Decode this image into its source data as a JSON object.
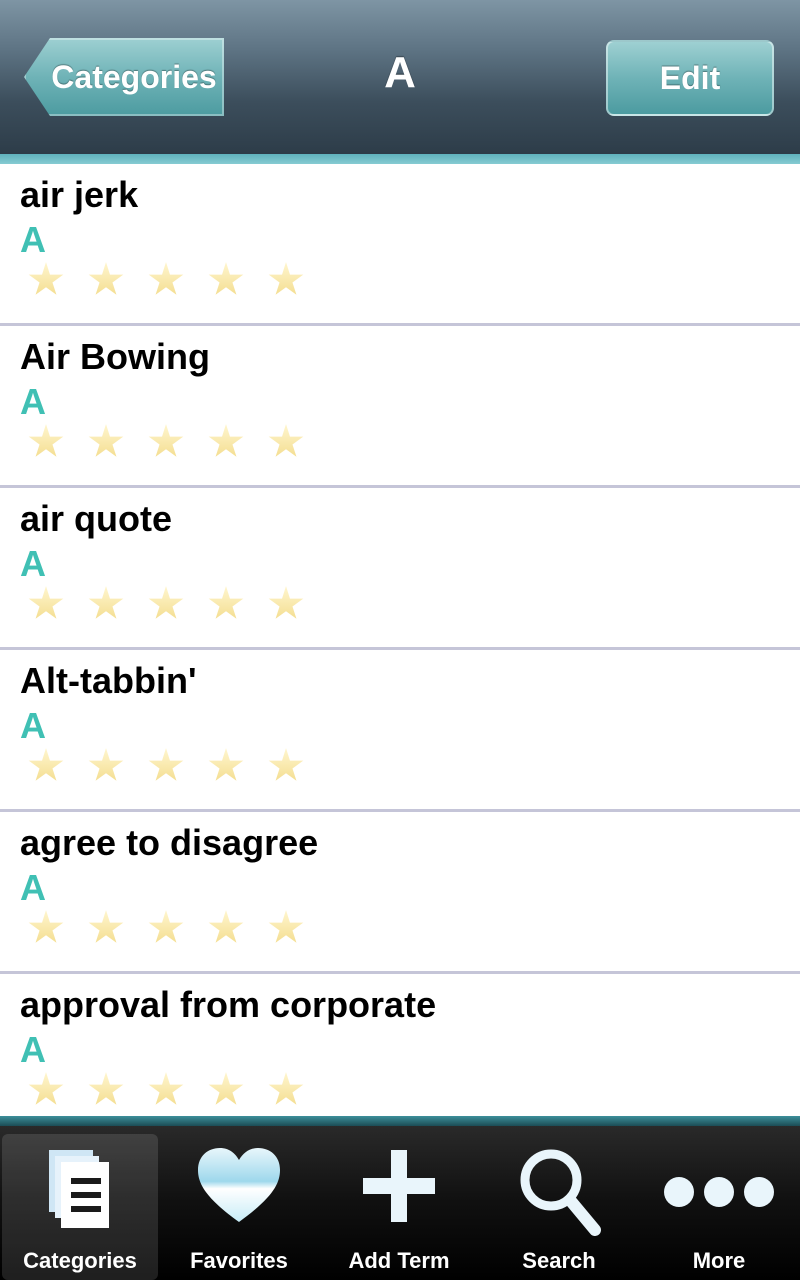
{
  "nav": {
    "back_label": "Categories",
    "title": "A",
    "edit_label": "Edit"
  },
  "terms": [
    {
      "term": "air jerk",
      "category": "A",
      "rating": 0
    },
    {
      "term": "Air Bowing",
      "category": "A",
      "rating": 0
    },
    {
      "term": "air quote",
      "category": "A",
      "rating": 0
    },
    {
      "term": "Alt-tabbin'",
      "category": "A",
      "rating": 0
    },
    {
      "term": "agree to disagree",
      "category": "A",
      "rating": 0
    },
    {
      "term": "approval from corporate",
      "category": "A",
      "rating": 0
    }
  ],
  "tabs": [
    {
      "label": "Categories",
      "icon": "documents-icon",
      "active": true
    },
    {
      "label": "Favorites",
      "icon": "heart-icon",
      "active": false
    },
    {
      "label": "Add Term",
      "icon": "plus-icon",
      "active": false
    },
    {
      "label": "Search",
      "icon": "search-icon",
      "active": false
    },
    {
      "label": "More",
      "icon": "more-icon",
      "active": false
    }
  ],
  "colors": {
    "accent": "#40c0b4",
    "button": "#6fb3b7",
    "star": "#f3dc8c"
  }
}
